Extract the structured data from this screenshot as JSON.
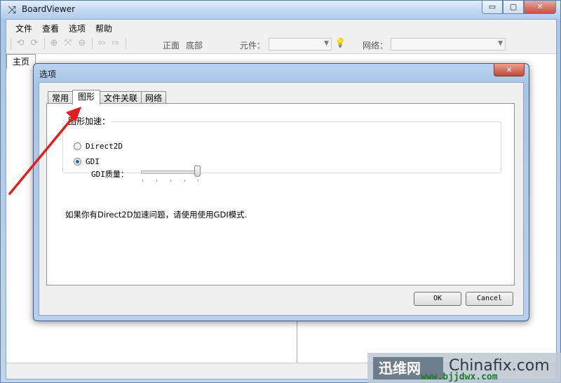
{
  "window": {
    "title": "BoardViewer",
    "controls": {
      "minimize": "▭",
      "maximize": "▢",
      "close": "✕"
    }
  },
  "menu": [
    "文件",
    "查看",
    "选项",
    "帮助"
  ],
  "toolbar": {
    "side_top": "正面",
    "side_bottom": "底部",
    "component_label": "元件：",
    "component_value": "",
    "network_label": "网络：",
    "network_value": ""
  },
  "doc_tab": "主页",
  "dialog": {
    "title": "选项",
    "tabs": [
      "常用",
      "图形",
      "文件关联",
      "网络"
    ],
    "active_tab": "图形",
    "group_title": "图形加速：",
    "options": [
      {
        "label": "Direct2D",
        "checked": false
      },
      {
        "label": "GDI",
        "checked": true
      }
    ],
    "quality_label": "GDI质量：",
    "quality_value": 1.0,
    "info": "如果你有Direct2D加速问题，请使用使用GDI模式.",
    "ok_label": "OK",
    "cancel_label": "Cancel"
  },
  "watermark": {
    "logo": "迅维网",
    "brand": "Chinafix.com",
    "url": "www.bjjdwx.com"
  },
  "colors": {
    "annotation_arrow": "#e02020",
    "radio_selected": "#2a5fa8"
  }
}
